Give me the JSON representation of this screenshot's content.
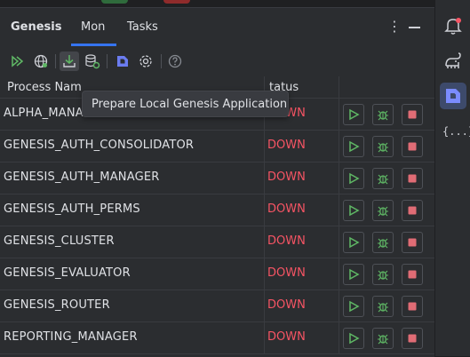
{
  "tabs": [
    {
      "label": "Genesis"
    },
    {
      "label": "Mon"
    },
    {
      "label": "Tasks"
    }
  ],
  "header": {
    "more_icon": "vertical-ellipsis-icon",
    "minimize_icon": "minimize-icon"
  },
  "toolbar": {
    "icons": [
      "run-all-icon",
      "globe-icon",
      "prepare-local-app-icon",
      "database-refresh-icon",
      "genesis-logo-icon",
      "settings-icon",
      "help-icon"
    ]
  },
  "tooltip": {
    "text": "Prepare Local Genesis Application"
  },
  "table": {
    "columns": [
      "Process Nam",
      "tatus"
    ],
    "rows": [
      {
        "name": "ALPHA_MANAGER",
        "status": "DOWN"
      },
      {
        "name": "GENESIS_AUTH_CONSOLIDATOR",
        "status": "DOWN"
      },
      {
        "name": "GENESIS_AUTH_MANAGER",
        "status": "DOWN"
      },
      {
        "name": "GENESIS_AUTH_PERMS",
        "status": "DOWN"
      },
      {
        "name": "GENESIS_CLUSTER",
        "status": "DOWN"
      },
      {
        "name": "GENESIS_EVALUATOR",
        "status": "DOWN"
      },
      {
        "name": "GENESIS_ROUTER",
        "status": "DOWN"
      },
      {
        "name": "REPORTING_MANAGER",
        "status": "DOWN"
      }
    ]
  },
  "sidebar": {
    "json_label": "{...}"
  },
  "colors": {
    "status_down": "#f75464",
    "accent": "#3574f0",
    "start_green": "#5fb865",
    "stop_red": "#e06c75"
  }
}
